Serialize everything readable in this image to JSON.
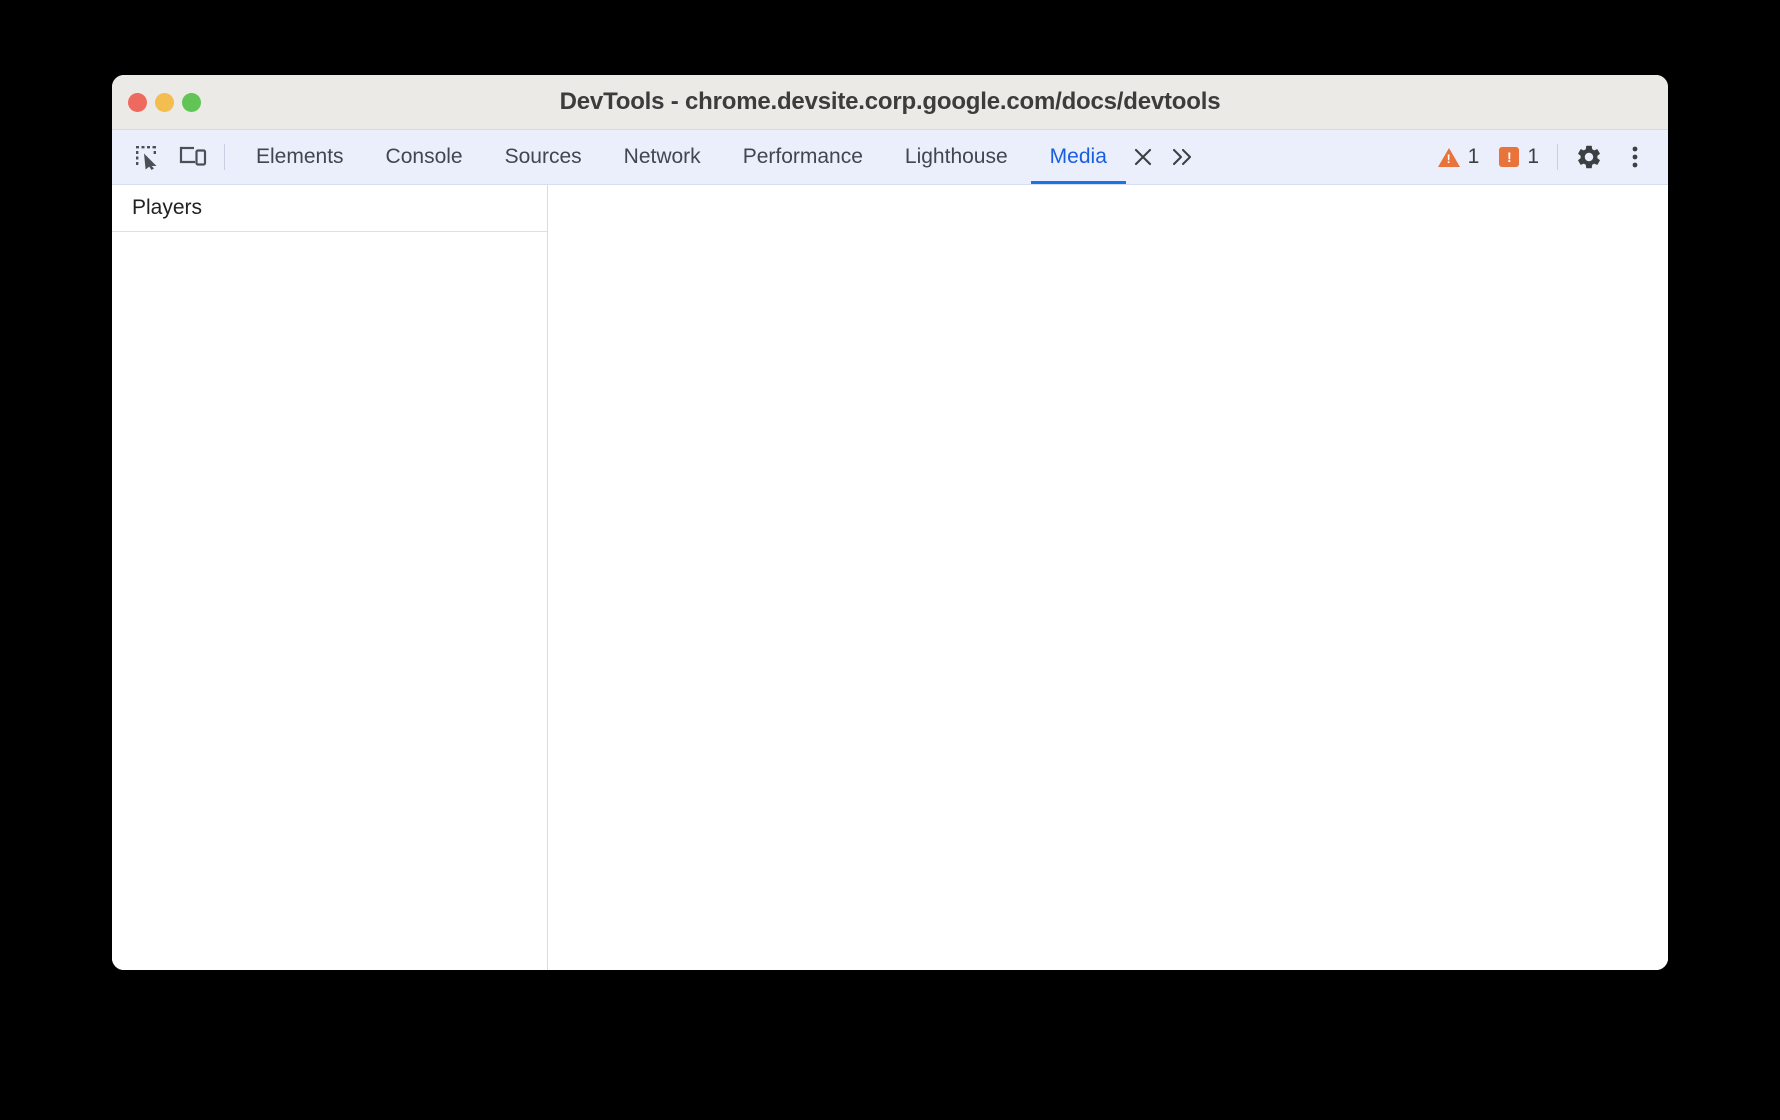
{
  "window": {
    "title": "DevTools - chrome.devsite.corp.google.com/docs/devtools",
    "traffic_lights": [
      {
        "name": "close",
        "color": "#ee6a5e"
      },
      {
        "name": "minimize",
        "color": "#f4bd4f"
      },
      {
        "name": "maximize",
        "color": "#61c454"
      }
    ]
  },
  "toolbar": {
    "inspect_icon": "inspect-element-icon",
    "device_icon": "device-toolbar-icon",
    "settings_icon": "gear-icon",
    "more_options_icon": "kebab-menu-icon",
    "more_tabs_icon": "chevron-double-right-icon",
    "close_tab_icon": "close-icon"
  },
  "tabs": [
    {
      "label": "Elements",
      "active": false
    },
    {
      "label": "Console",
      "active": false
    },
    {
      "label": "Sources",
      "active": false
    },
    {
      "label": "Network",
      "active": false
    },
    {
      "label": "Performance",
      "active": false
    },
    {
      "label": "Lighthouse",
      "active": false
    },
    {
      "label": "Media",
      "active": true
    }
  ],
  "status": {
    "warnings": {
      "icon": "warning-triangle-icon",
      "count": "1",
      "color": "#e8743b"
    },
    "errors": {
      "icon": "error-square-icon",
      "count": "1",
      "color": "#e8743b"
    }
  },
  "media_panel": {
    "sidebar": {
      "header": "Players",
      "items": []
    },
    "content": ""
  },
  "colors": {
    "accent": "#1a73e8",
    "tabbar_bg": "#ebeffb",
    "titlebar_bg": "#eceae7",
    "panel_bg": "#ffffff",
    "divider": "#d3ddf2"
  }
}
